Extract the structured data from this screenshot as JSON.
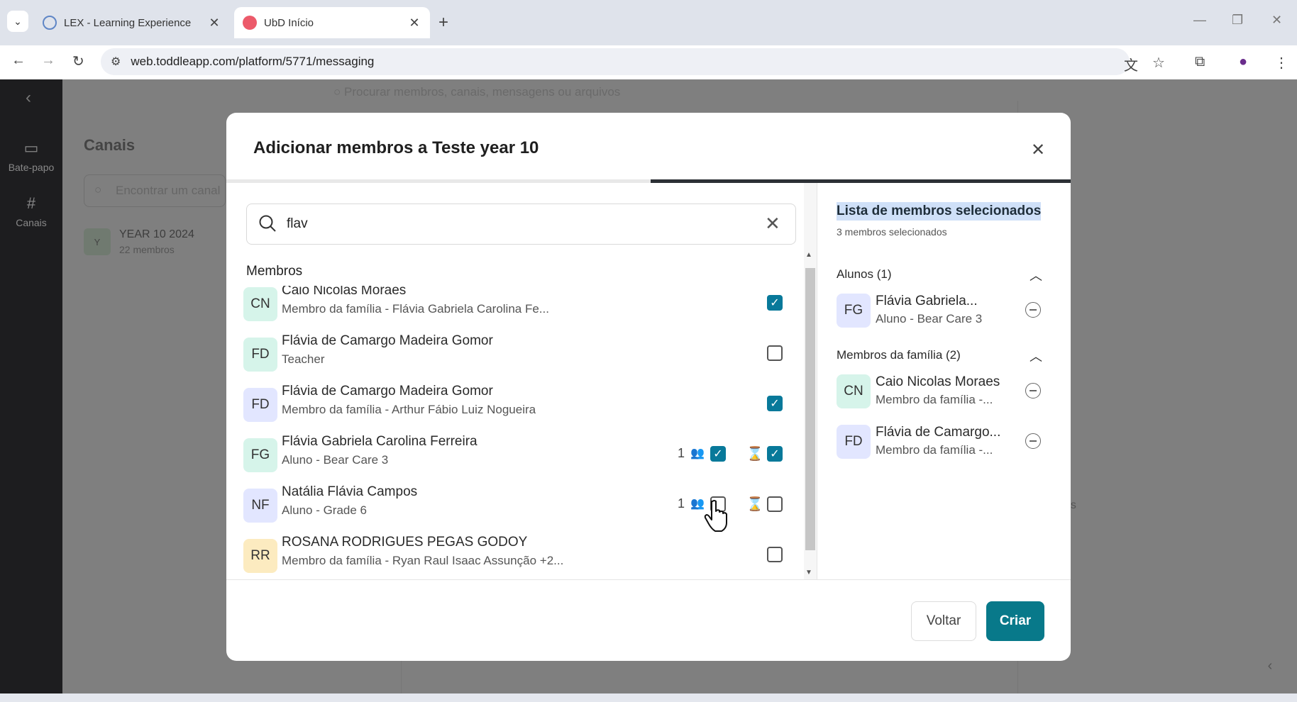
{
  "browser": {
    "tabs": [
      {
        "title": "LEX - Learning Experience",
        "active": false
      },
      {
        "title": "UbD Início",
        "active": true
      }
    ],
    "url": "web.toddleapp.com/platform/5771/messaging"
  },
  "app": {
    "nav": {
      "chat_label": "Bate-papo",
      "channels_label": "Canais"
    },
    "search_placeholder": "Procurar membros, canais, mensagens ou arquivos",
    "channels_title": "Canais",
    "find_channel_placeholder": "Encontrar um canal",
    "channel": {
      "initial": "Y",
      "name": "YEAR 10 2024",
      "count": "22 membros"
    },
    "fragment_text": "ns"
  },
  "modal": {
    "title": "Adicionar membros a Teste year 10",
    "progress_step": 2,
    "progress_total": 2,
    "search_value": "flav",
    "members_label": "Membros",
    "members": [
      {
        "initials": "CN",
        "name": "Caio Nicolas Moraes",
        "subtitle": "Membro da família - Flávia Gabriela Carolina Fe...",
        "checked": true
      },
      {
        "initials": "FD",
        "name": "Flávia de Camargo Madeira Gomor",
        "subtitle": "Teacher",
        "checked": false
      },
      {
        "initials": "FD",
        "name": "Flávia de Camargo Madeira Gomor",
        "subtitle": "Membro da família - Arthur Fábio Luiz Nogueira",
        "checked": true
      },
      {
        "initials": "FG",
        "name": "Flávia Gabriela Carolina Ferreira",
        "subtitle": "Aluno - Bear Care 3",
        "guardians": "1",
        "parents_checked": true,
        "checked": true
      },
      {
        "initials": "NF",
        "name": "Natália Flávia Campos",
        "subtitle": "Aluno - Grade 6",
        "guardians": "1",
        "parents_checked": false,
        "checked": false
      },
      {
        "initials": "RR",
        "name": "ROSANA RODRIGUES PEGAS GODOY",
        "subtitle": "Membro da família - Ryan Raul Isaac Assunção +2...",
        "checked": false
      }
    ],
    "selected": {
      "title": "Lista de membros selecionados",
      "count_text": "3 membros selecionados",
      "groups": [
        {
          "label": "Alunos (1)",
          "items": [
            {
              "initials": "FG",
              "name": "Flávia Gabriela...",
              "subtitle": "Aluno - Bear Care 3"
            }
          ]
        },
        {
          "label": "Membros da família (2)",
          "items": [
            {
              "initials": "CN",
              "name": "Caio Nicolas Moraes",
              "subtitle": "Membro da família -..."
            },
            {
              "initials": "FD",
              "name": "Flávia de Camargo...",
              "subtitle": "Membro da família -..."
            }
          ]
        }
      ]
    },
    "back_label": "Voltar",
    "create_label": "Criar"
  },
  "colors": {
    "accent": "#08798a",
    "checkbox": "#08799a"
  },
  "icons": [
    "search-icon",
    "close-icon",
    "checkmark-icon",
    "guardians-icon",
    "hourglass-icon",
    "remove-icon",
    "chevron-up-icon"
  ]
}
